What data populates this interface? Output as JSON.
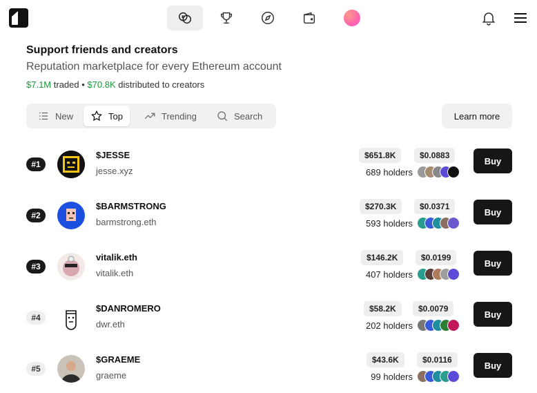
{
  "nav": {
    "tabs": [
      {
        "icon": "coins-icon",
        "active": true
      },
      {
        "icon": "trophy-icon",
        "active": false
      },
      {
        "icon": "compass-icon",
        "active": false
      },
      {
        "icon": "wallet-icon",
        "active": false
      }
    ]
  },
  "hero": {
    "title": "Support friends and creators",
    "subtitle": "Reputation marketplace for every Ethereum account",
    "traded_value": "$7.1M",
    "traded_label": "traded •",
    "distributed_value": "$70.8K",
    "distributed_label": "distributed to creators"
  },
  "filters": [
    {
      "label": "New",
      "icon": "list-icon"
    },
    {
      "label": "Top",
      "icon": "star-icon",
      "active": true
    },
    {
      "label": "Trending",
      "icon": "trending-up-icon"
    },
    {
      "label": "Search",
      "icon": "search-icon"
    }
  ],
  "learn_more": "Learn more",
  "buy_label": "Buy",
  "colors": {
    "accent_green": "#1a9a3a",
    "button_dark": "#161616"
  },
  "rows": [
    {
      "rank": "#1",
      "name": "$JESSE",
      "handle": "jesse.xyz",
      "market_cap": "$651.8K",
      "price": "$0.0883",
      "holders": "689 holders"
    },
    {
      "rank": "#2",
      "name": "$BARMSTRONG",
      "handle": "barmstrong.eth",
      "market_cap": "$270.3K",
      "price": "$0.0371",
      "holders": "593 holders"
    },
    {
      "rank": "#3",
      "name": "vitalik.eth",
      "handle": "vitalik.eth",
      "market_cap": "$146.2K",
      "price": "$0.0199",
      "holders": "407 holders"
    },
    {
      "rank": "#4",
      "name": "$DANROMERO",
      "handle": "dwr.eth",
      "market_cap": "$58.2K",
      "price": "$0.0079",
      "holders": "202 holders"
    },
    {
      "rank": "#5",
      "name": "$GRAEME",
      "handle": "graeme",
      "market_cap": "$43.6K",
      "price": "$0.0116",
      "holders": "99 holders"
    }
  ]
}
